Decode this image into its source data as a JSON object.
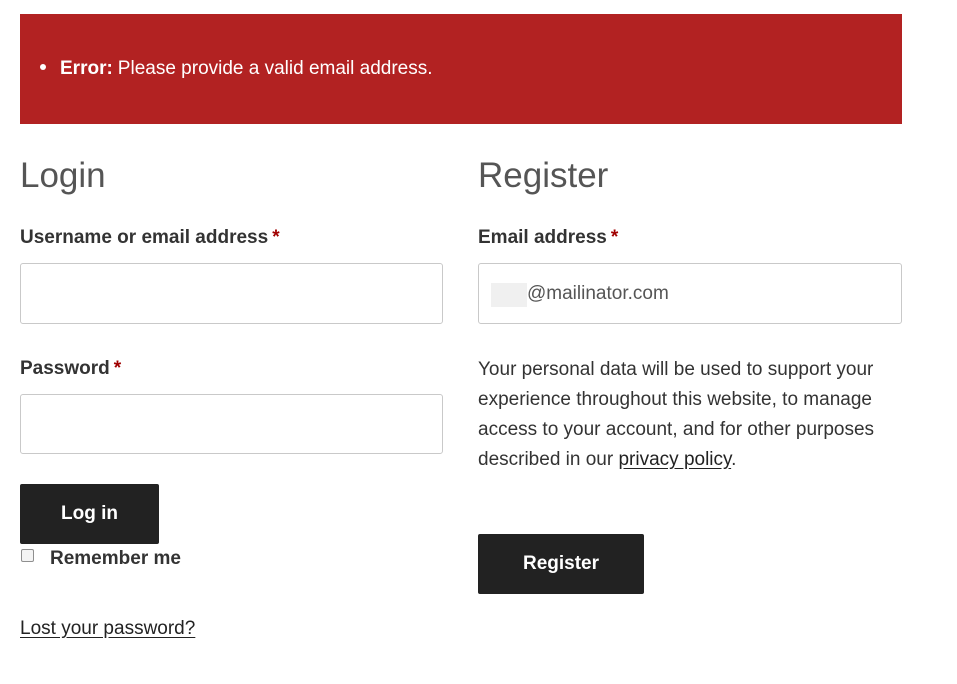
{
  "notice": {
    "label": "Error:",
    "message": "Please provide a valid email address."
  },
  "login": {
    "title": "Login",
    "username_label": "Username or email address",
    "username_value": "",
    "password_label": "Password",
    "password_value": "",
    "required_marker": "*",
    "submit_label": "Log in",
    "remember_label": "Remember me",
    "remember_checked": false,
    "lost_password_link": "Lost your password?"
  },
  "register": {
    "title": "Register",
    "email_label": "Email address",
    "email_value": "@mailinator.com",
    "required_marker": "*",
    "privacy_text_before": "Your personal data will be used to support your experience throughout this website, to manage access to your account, and for other purposes described in our",
    "privacy_link": "privacy policy",
    "privacy_text_after": ".",
    "submit_label": "Register"
  },
  "colors": {
    "error_background": "#b22222",
    "button_background": "#222222",
    "required_marker": "#a00000"
  }
}
